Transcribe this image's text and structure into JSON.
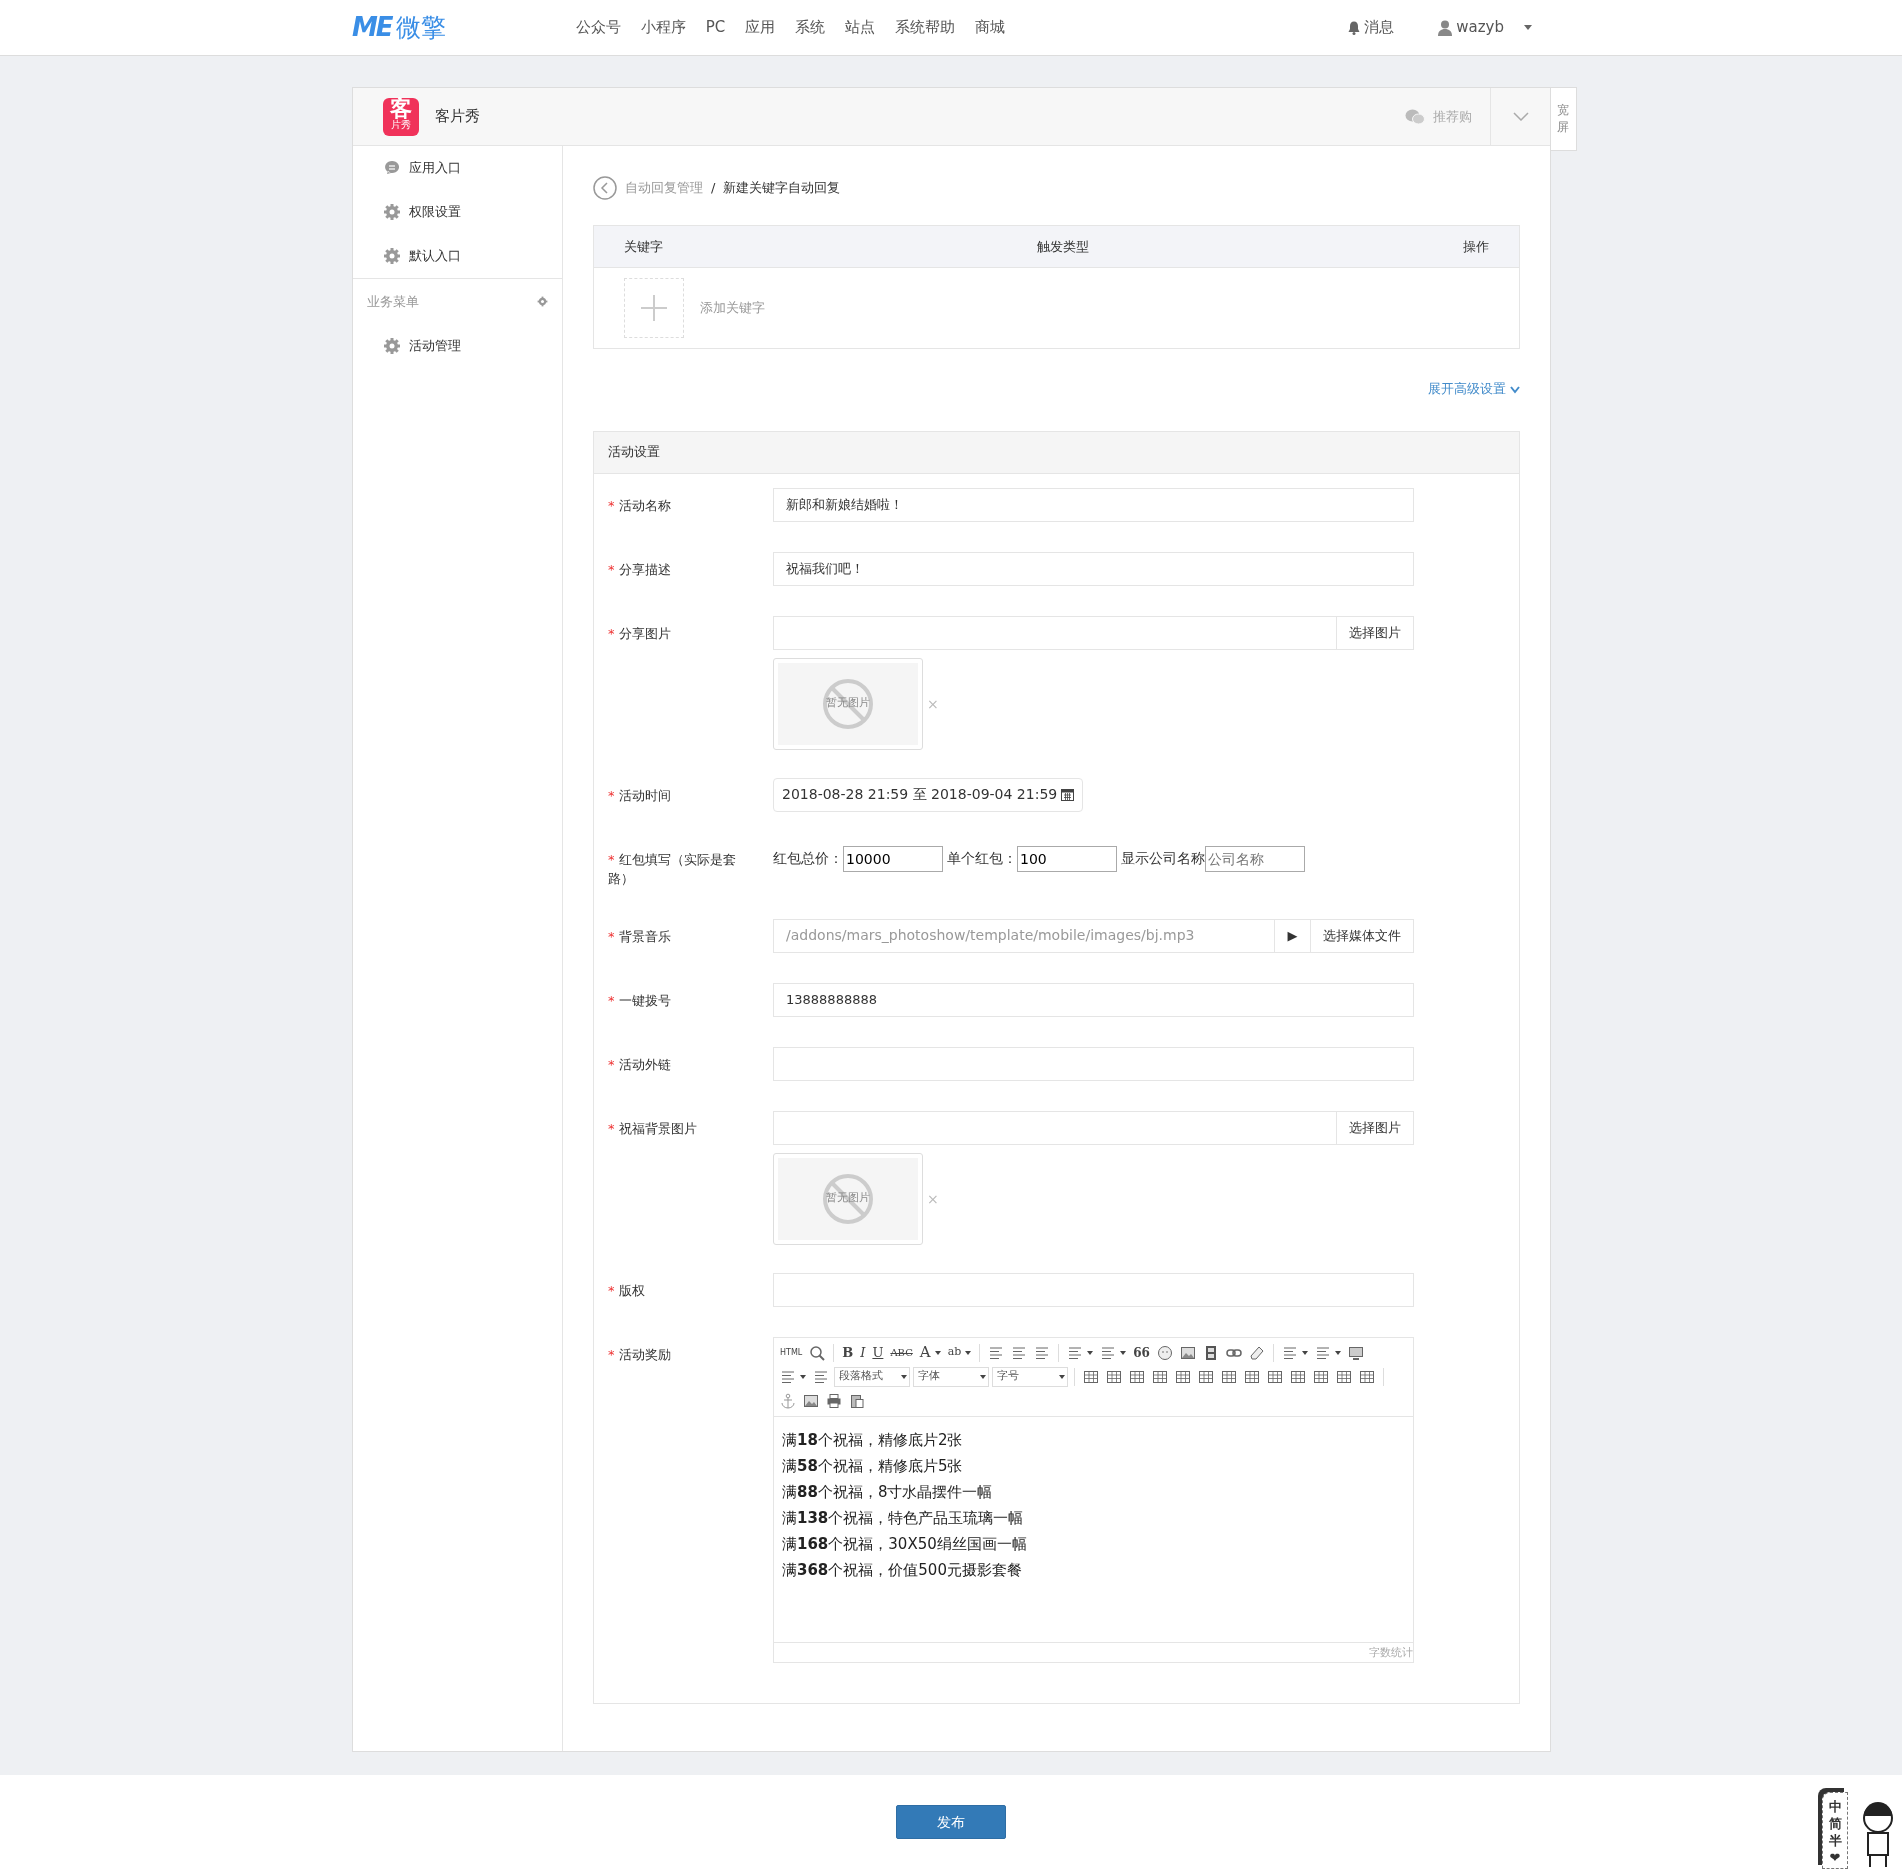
{
  "navbar": {
    "logo_mark": "ME",
    "logo_text": "微擎",
    "menu": [
      "公众号",
      "小程序",
      "PC",
      "应用",
      "系统",
      "站点",
      "系统帮助",
      "商城"
    ],
    "notifications": "消息",
    "user": "wazyb"
  },
  "app": {
    "icon_text": "客",
    "icon_subtext": "片秀",
    "name": "客片秀",
    "recommend": "推荐购",
    "wide_screen": "宽屏"
  },
  "sidebar": {
    "items": [
      {
        "label": "应用入口",
        "kind": "chat"
      },
      {
        "label": "权限设置",
        "kind": "gear"
      },
      {
        "label": "默认入口",
        "kind": "gear"
      }
    ],
    "section_title": "业务菜单",
    "section_items": [
      {
        "label": "活动管理",
        "kind": "gear"
      }
    ]
  },
  "breadcrumb": [
    "自动回复管理",
    "新建关键字自动回复"
  ],
  "breadcrumb_separator": "/",
  "required_mark": "*",
  "keyword_table": {
    "columns": [
      "关键字",
      "触发类型",
      "操作"
    ],
    "add_label": "添加关键字"
  },
  "advanced_link": "展开高级设置",
  "panel": {
    "title": "活动设置",
    "fields": [
      {
        "kind": "text",
        "label": "活动名称",
        "value": "新郎和新娘结婚啦！"
      },
      {
        "kind": "text",
        "label": "分享描述",
        "value": "祝福我们吧！"
      },
      {
        "kind": "image",
        "label": "分享图片",
        "button": "选择图片",
        "preview": "暂无图片",
        "remove": "×"
      },
      {
        "kind": "daterange",
        "label": "活动时间",
        "value": "2018-08-28 21:59 至 2018-09-04 21:59"
      },
      {
        "kind": "redpacket",
        "label": "红包填写（实际是套路）",
        "parts": [
          {
            "label": "红包总价：",
            "value": "10000"
          },
          {
            "label": "单个红包：",
            "value": "100"
          },
          {
            "label": "显示公司名称",
            "placeholder": "公司名称"
          }
        ]
      },
      {
        "kind": "media",
        "label": "背景音乐",
        "value": "/addons/mars_photoshow/template/mobile/images/bj.mp3",
        "play": "▶",
        "button": "选择媒体文件"
      },
      {
        "kind": "text",
        "label": "一键拨号",
        "value": "13888888888"
      },
      {
        "kind": "text",
        "label": "活动外链"
      },
      {
        "kind": "image",
        "label": "祝福背景图片",
        "button": "选择图片",
        "preview": "暂无图片",
        "remove": "×"
      },
      {
        "kind": "text",
        "label": "版权"
      },
      {
        "kind": "editor",
        "label": "活动奖励",
        "toolbar": [
          [
            {
              "kind": "glyph",
              "label": "HTML"
            },
            {
              "kind": "search"
            },
            {
              "kind": "sep"
            },
            {
              "kind": "glyph",
              "label": "B"
            },
            {
              "kind": "glyph",
              "label": "I"
            },
            {
              "kind": "glyph",
              "label": "U"
            },
            {
              "kind": "glyph",
              "label": "ABC"
            },
            {
              "kind": "glyph",
              "label": "A",
              "dropdown": true
            },
            {
              "kind": "glyph",
              "label": "ab",
              "dropdown": true
            },
            {
              "kind": "sep"
            },
            {
              "kind": "lines"
            },
            {
              "kind": "lines"
            },
            {
              "kind": "lines"
            },
            {
              "kind": "sep"
            },
            {
              "kind": "lines",
              "dropdown": true
            },
            {
              "kind": "lines",
              "dropdown": true
            },
            {
              "kind": "glyph",
              "label": "66"
            },
            {
              "kind": "circle"
            },
            {
              "kind": "image"
            },
            {
              "kind": "film"
            },
            {
              "kind": "link"
            },
            {
              "kind": "eraser"
            },
            {
              "kind": "sep"
            },
            {
              "kind": "lines",
              "dropdown": true
            },
            {
              "kind": "lines",
              "dropdown": true
            },
            {
              "kind": "monitor"
            }
          ],
          [
            {
              "kind": "lines",
              "dropdown": true
            },
            {
              "kind": "lines"
            },
            {
              "kind": "select",
              "label": "段落格式"
            },
            {
              "kind": "select",
              "label": "字体"
            },
            {
              "kind": "select",
              "label": "字号"
            },
            {
              "kind": "sep"
            },
            {
              "kind": "grid"
            },
            {
              "kind": "grid"
            },
            {
              "kind": "grid"
            },
            {
              "kind": "grid"
            },
            {
              "kind": "grid"
            },
            {
              "kind": "grid"
            },
            {
              "kind": "grid"
            },
            {
              "kind": "grid"
            },
            {
              "kind": "grid"
            },
            {
              "kind": "grid"
            },
            {
              "kind": "grid"
            },
            {
              "kind": "grid"
            },
            {
              "kind": "grid"
            },
            {
              "kind": "sep"
            }
          ],
          [
            {
              "kind": "anchor"
            },
            {
              "kind": "image"
            },
            {
              "kind": "print"
            },
            {
              "kind": "paste"
            }
          ]
        ],
        "lines": [
          "满**18**个祝福，精修底片2张",
          "满**58**个祝福，精修底片5张",
          "满**88**个祝福，8寸水晶摆件一幅",
          "满**138**个祝福，特色产品玉琉璃一幅",
          "满**168**个祝福，30X50绢丝国画一幅",
          "满**368**个祝福，价值500元摄影套餐"
        ],
        "word_count": "字数统计"
      }
    ]
  },
  "publish_button": "发布",
  "ime_bar": [
    "中",
    "简",
    "半",
    "❤"
  ]
}
